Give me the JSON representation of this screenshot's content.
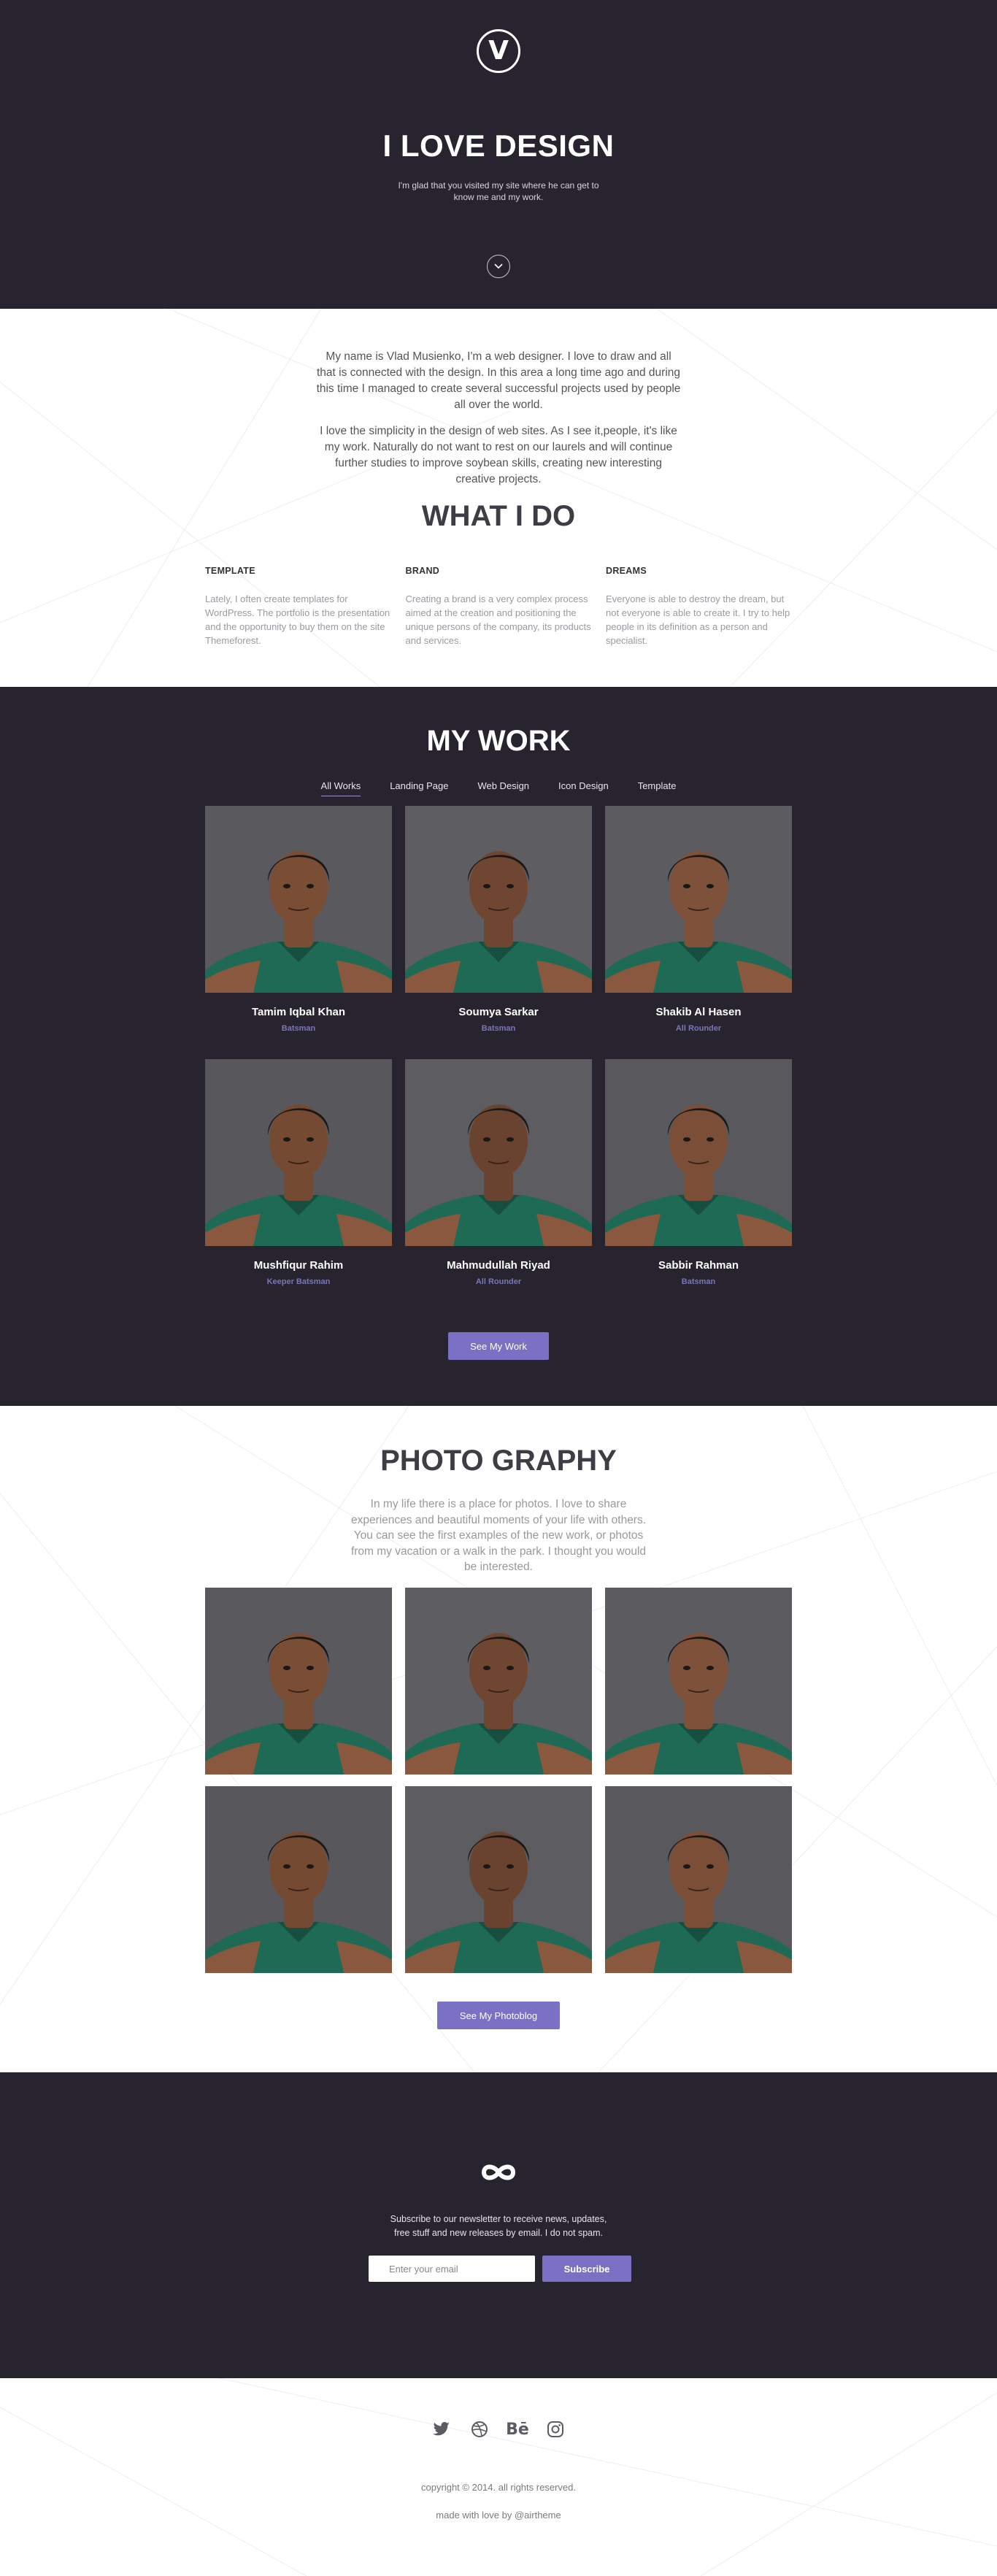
{
  "hero": {
    "logo_letter": "V",
    "title": "I LOVE DESIGN",
    "subtitle": "I'm glad that you visited my site where he can get to know me and my work.",
    "scroll_icon": "chevron-down-icon"
  },
  "about": {
    "paragraph1": "My name is Vlad Musienko, I'm a web designer. I love to draw and all that is connected with the design. In this area a long time ago and during this time I managed to create several successful projects used by people all over the world.",
    "paragraph2": "I love the simplicity in the design of web sites. As I see it,people, it's like my work. Naturally do not want to rest on our laurels and will continue further studies to improve soybean skills, creating new interesting creative projects."
  },
  "what_i_do": {
    "title": "WHAT I DO",
    "services": [
      {
        "title": "TEMPLATE",
        "text": "Lately, I often create templates for WordPress. The portfolio is the presentation and the opportunity to buy them on the site Themeforest."
      },
      {
        "title": "BRAND",
        "text": "Creating a brand is a very complex process aimed at the creation and positioning the unique persons of the company, its products and services."
      },
      {
        "title": "DREAMS",
        "text": "Everyone is able to destroy the dream, but not everyone is able to create it. I try to help people in its definition as a person and specialist."
      }
    ]
  },
  "my_work": {
    "title": "MY WORK",
    "filters": [
      {
        "label": "All Works",
        "active": true
      },
      {
        "label": "Landing Page",
        "active": false
      },
      {
        "label": "Web Design",
        "active": false
      },
      {
        "label": "Icon Design",
        "active": false
      },
      {
        "label": "Template",
        "active": false
      }
    ],
    "cards": [
      {
        "name": "Tamim Iqbal Khan",
        "role": "Batsman"
      },
      {
        "name": "Soumya Sarkar",
        "role": "Batsman"
      },
      {
        "name": "Shakib Al Hasen",
        "role": "All Rounder"
      },
      {
        "name": "Mushfiqur Rahim",
        "role": "Keeper Batsman"
      },
      {
        "name": "Mahmudullah Riyad",
        "role": "All Rounder"
      },
      {
        "name": "Sabbir Rahman",
        "role": "Batsman"
      }
    ],
    "button_label": "See My Work"
  },
  "photography": {
    "title": "PHOTO GRAPHY",
    "text": "In my life there is a place for photos. I love to share experiences and beautiful moments of your life with others. You can see the first examples of the new work, or photos from my vacation or a walk in the park. I thought you would be interested.",
    "button_label": "See My Photoblog"
  },
  "subscribe": {
    "icon": "infinity-icon",
    "text": "Subscribe to our newsletter to receive news, updates, free stuff and new releases by email. I do not spam.",
    "email_placeholder": "Enter your email",
    "button_label": "Subscribe"
  },
  "footer": {
    "socials": [
      "twitter-icon",
      "dribbble-icon",
      "behance-icon",
      "instagram-icon"
    ],
    "behance_text": "Bē",
    "copyright": "copyright © 2014. all rights reserved.",
    "made_with": "made with love by @airtheme"
  },
  "colors": {
    "dark_bg": "#27232f",
    "accent": "#7a70c4",
    "role_text": "#7b76b5"
  }
}
